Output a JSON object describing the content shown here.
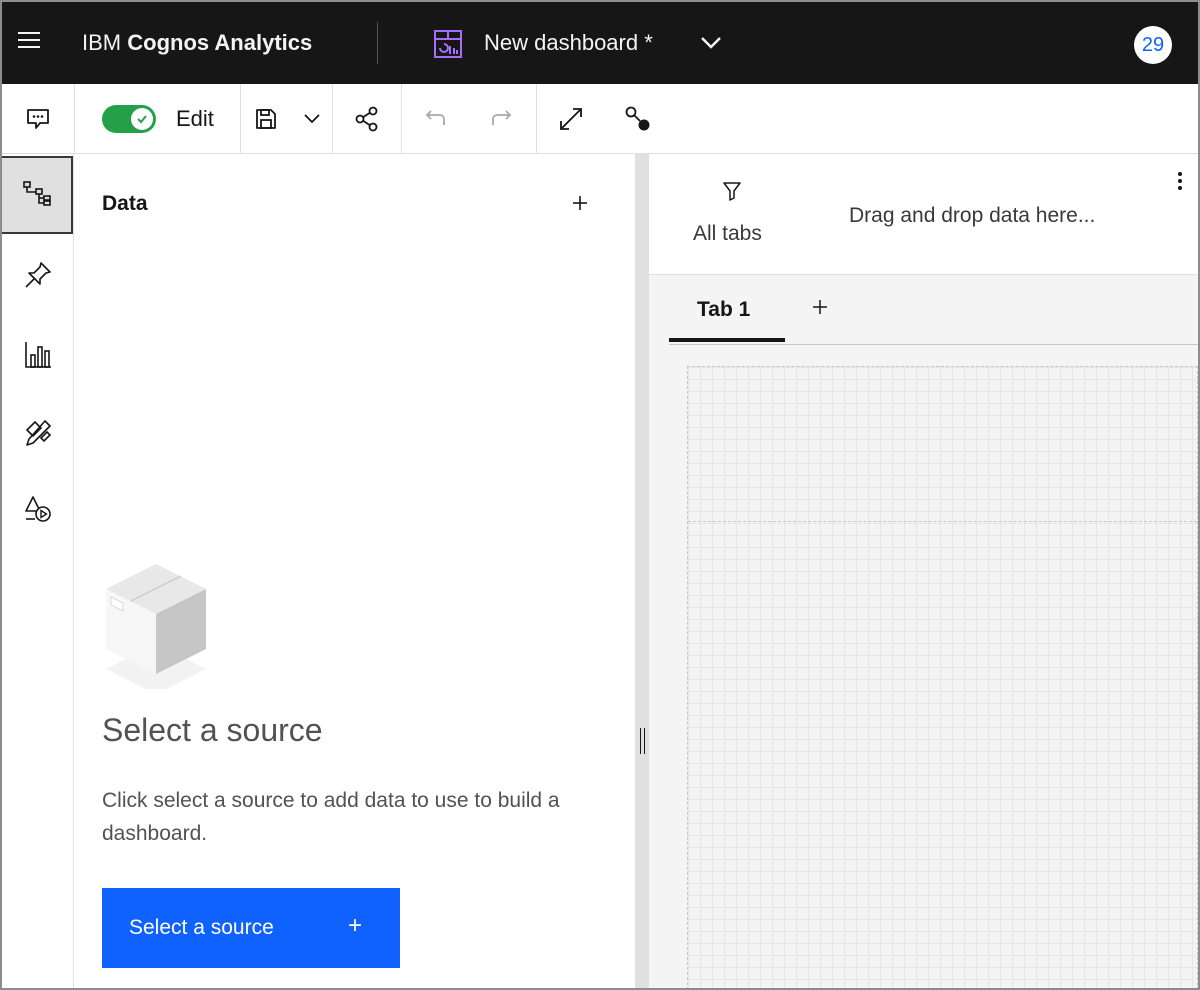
{
  "masthead": {
    "brand_prefix": "IBM",
    "brand_name": "Cognos Analytics",
    "dashboard_title": "New dashboard *",
    "notification_count": "29",
    "menu_icon": "hamburger-icon",
    "dashboard_icon": "dashboard-icon",
    "chevron_icon": "chevron-down-icon"
  },
  "toolbar": {
    "edit_label": "Edit",
    "edit_enabled": true,
    "icons": [
      "chat-icon",
      "save-icon",
      "chevron-down-icon",
      "share-icon",
      "undo-icon",
      "redo-icon",
      "fullscreen-icon",
      "connect-icon"
    ]
  },
  "rail": {
    "items": [
      {
        "name": "data-sources",
        "icon": "data-tree-icon",
        "active": true
      },
      {
        "name": "pins",
        "icon": "pin-icon",
        "active": false
      },
      {
        "name": "visualizations",
        "icon": "chart-icon",
        "active": false
      },
      {
        "name": "assets",
        "icon": "tools-icon",
        "active": false
      },
      {
        "name": "widgets",
        "icon": "shapes-media-icon",
        "active": false
      }
    ]
  },
  "data_panel": {
    "title": "Data",
    "empty_title": "Select a source",
    "empty_description": "Click select a source to add data to use to build a dashboard.",
    "select_button_label": "Select a source",
    "select_button_plus": "+"
  },
  "canvas": {
    "filter_label": "All tabs",
    "drop_hint": "Drag and drop data here...",
    "tabs": [
      {
        "label": "Tab 1",
        "selected": true
      }
    ],
    "add_tab_icon": "plus-icon"
  },
  "colors": {
    "masthead_bg": "#161616",
    "toggle_on": "#24a148",
    "primary_button": "#0f62fe",
    "notification_text": "#0f62fe",
    "dashboard_icon": "#a56eff"
  }
}
